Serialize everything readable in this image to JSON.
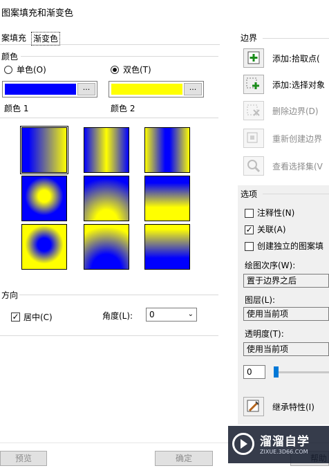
{
  "window": {
    "title": "图案填充和渐变色"
  },
  "tabs": [
    {
      "label": "案填充"
    },
    {
      "label": "渐变色"
    }
  ],
  "color_section": {
    "label": "颜色",
    "single": {
      "label": "单色(O)",
      "selected": false
    },
    "double": {
      "label": "双色(T)",
      "selected": true
    },
    "color1": {
      "label": "颜色 1",
      "value": "#0000ff",
      "btn": "..."
    },
    "color2": {
      "label": "颜色 2",
      "value": "#ffff00",
      "btn": "..."
    }
  },
  "gradients": [
    {
      "pattern": "linear-horizontal",
      "selected": true
    },
    {
      "pattern": "cylinder-vertical"
    },
    {
      "pattern": "inverted-cylinder-vertical"
    },
    {
      "pattern": "spherical"
    },
    {
      "pattern": "hemispherical-top"
    },
    {
      "pattern": "curved-top"
    },
    {
      "pattern": "inverted-spherical"
    },
    {
      "pattern": "inverted-hemispherical"
    },
    {
      "pattern": "inverted-curved"
    }
  ],
  "orientation": {
    "label": "方向",
    "centered": {
      "label": "居中(C)",
      "checked": true
    },
    "angle": {
      "label": "角度(L):",
      "value": "0"
    }
  },
  "boundaries": {
    "label": "边界",
    "actions": [
      {
        "label": "添加:拾取点(",
        "icon": "pick-point-icon",
        "enabled": true
      },
      {
        "label": "添加:选择对象",
        "icon": "select-objects-icon",
        "enabled": true
      },
      {
        "label": "删除边界(D)",
        "icon": "remove-boundary-icon",
        "enabled": false
      },
      {
        "label": "重新创建边界",
        "icon": "recreate-boundary-icon",
        "enabled": false
      },
      {
        "label": "查看选择集(V",
        "icon": "view-selections-icon",
        "enabled": false
      }
    ]
  },
  "options": {
    "label": "选项",
    "annotative": {
      "label": "注释性(N)",
      "checked": false
    },
    "associative": {
      "label": "关联(A)",
      "checked": true
    },
    "separate": {
      "label": "创建独立的图案填",
      "checked": false
    },
    "draw_order": {
      "label": "绘图次序(W):",
      "value": "置于边界之后"
    },
    "layer": {
      "label": "图层(L):",
      "value": "使用当前项"
    },
    "transparency": {
      "label": "透明度(T):",
      "value": "使用当前项"
    },
    "transparency_value": "0"
  },
  "inherit": {
    "label": "继承特性(I)"
  },
  "footer": {
    "preview": "预览",
    "ok": "确定",
    "help": "帮助"
  },
  "watermark": {
    "title": "溜溜自学",
    "subtitle": "ZIXUE.3D66.COM"
  },
  "colors": {
    "blue": "#0000ff",
    "yellow": "#ffff00"
  }
}
